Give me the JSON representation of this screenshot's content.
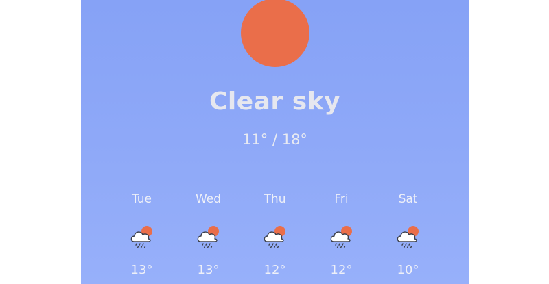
{
  "current": {
    "icon": "sun-icon",
    "condition": "Clear sky",
    "temp_range": "11° / 18°"
  },
  "colors": {
    "sun": "#ea6e4a",
    "background_top": "#86a2f6",
    "background_bottom": "#97b0fa",
    "text": "#e6e7ef"
  },
  "forecast": [
    {
      "day": "Tue",
      "icon": "cloud-sun-rain-icon",
      "temp": "13°"
    },
    {
      "day": "Wed",
      "icon": "cloud-sun-rain-icon",
      "temp": "13°"
    },
    {
      "day": "Thu",
      "icon": "cloud-sun-rain-icon",
      "temp": "12°"
    },
    {
      "day": "Fri",
      "icon": "cloud-sun-rain-icon",
      "temp": "12°"
    },
    {
      "day": "Sat",
      "icon": "cloud-sun-rain-icon",
      "temp": "10°"
    }
  ]
}
